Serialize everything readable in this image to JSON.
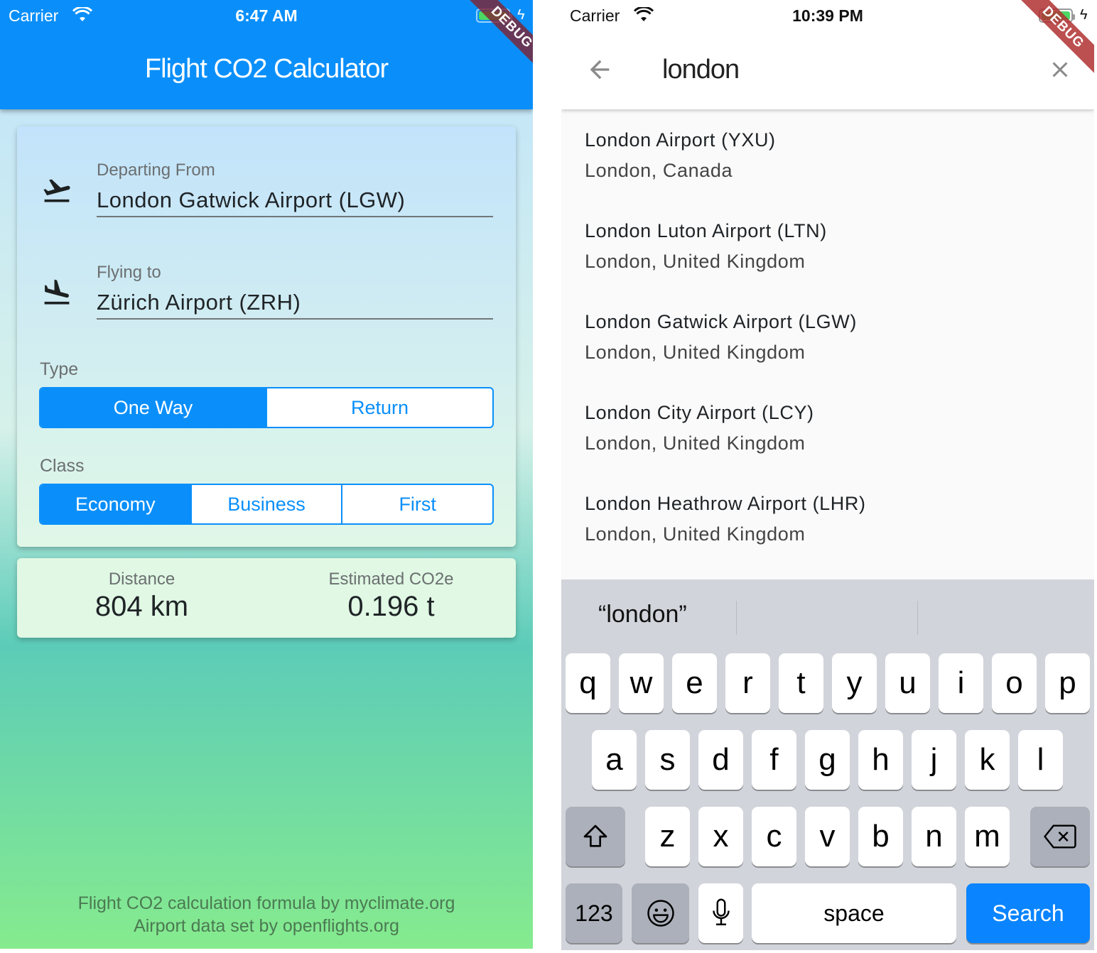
{
  "left_screen": {
    "status": {
      "carrier": "Carrier",
      "time": "6:47 AM"
    },
    "debug_ribbon": "DEBUG",
    "appbar": {
      "title": "Flight CO2 Calculator"
    },
    "departure": {
      "icon": "flight-takeoff-icon",
      "label": "Departing From",
      "value": "London Gatwick Airport (LGW)"
    },
    "arrival": {
      "icon": "flight-land-icon",
      "label": "Flying to",
      "value": "Zürich Airport (ZRH)"
    },
    "type": {
      "label": "Type",
      "options": [
        {
          "label": "One Way",
          "selected": true
        },
        {
          "label": "Return",
          "selected": false
        }
      ]
    },
    "class": {
      "label": "Class",
      "options": [
        {
          "label": "Economy",
          "selected": true
        },
        {
          "label": "Business",
          "selected": false
        },
        {
          "label": "First",
          "selected": false
        }
      ]
    },
    "results": {
      "distance_label": "Distance",
      "distance_value": "804 km",
      "co2_label": "Estimated CO2e",
      "co2_value": "0.196 t"
    },
    "footer": {
      "line1": "Flight CO2 calculation formula by myclimate.org",
      "line2": "Airport data set by openflights.org"
    },
    "colors": {
      "primary": "#0a8ffa",
      "battery": "#4cd964"
    }
  },
  "right_screen": {
    "status": {
      "carrier": "Carrier",
      "time": "10:39 PM"
    },
    "debug_ribbon": "DEBUG",
    "search": {
      "query": "london",
      "back_icon": "arrow-left-icon",
      "clear_icon": "close-icon"
    },
    "results": [
      {
        "title": "London Airport (YXU)",
        "subtitle": "London, Canada"
      },
      {
        "title": "London Luton Airport (LTN)",
        "subtitle": "London, United Kingdom"
      },
      {
        "title": "London Gatwick Airport (LGW)",
        "subtitle": "London, United Kingdom"
      },
      {
        "title": "London City Airport (LCY)",
        "subtitle": "London, United Kingdom"
      },
      {
        "title": "London Heathrow Airport (LHR)",
        "subtitle": "London, United Kingdom"
      }
    ],
    "keyboard": {
      "prediction": "“london”",
      "row1": [
        "q",
        "w",
        "e",
        "r",
        "t",
        "y",
        "u",
        "i",
        "o",
        "p"
      ],
      "row2": [
        "a",
        "s",
        "d",
        "f",
        "g",
        "h",
        "j",
        "k",
        "l"
      ],
      "row3": [
        "z",
        "x",
        "c",
        "v",
        "b",
        "n",
        "m"
      ],
      "numbers_key": "123",
      "space_key": "space",
      "search_key": "Search"
    }
  }
}
